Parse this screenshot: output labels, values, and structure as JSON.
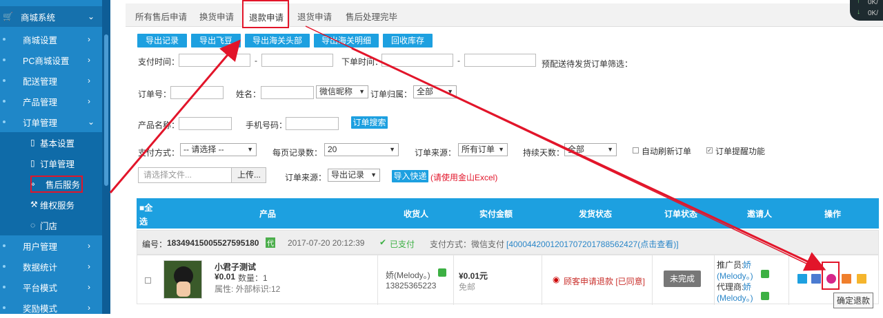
{
  "sidebar": {
    "header": "商城系统",
    "items": [
      {
        "label": "商城设置"
      },
      {
        "label": "PC商城设置"
      },
      {
        "label": "配送管理"
      },
      {
        "label": "产品管理"
      },
      {
        "label": "订单管理"
      }
    ],
    "subitems": [
      {
        "label": "基本设置"
      },
      {
        "label": "订单管理"
      },
      {
        "label": "售后服务"
      },
      {
        "label": "维权服务"
      },
      {
        "label": "门店"
      }
    ],
    "items2": [
      {
        "label": "用户管理"
      },
      {
        "label": "数据统计"
      },
      {
        "label": "平台模式"
      },
      {
        "label": "奖励模式"
      }
    ]
  },
  "tabs": [
    "所有售后申请",
    "换货申请",
    "退款申请",
    "退货申请",
    "售后处理完毕"
  ],
  "toolbar": [
    "导出记录",
    "导出飞豆",
    "导出海关头部",
    "导出海关明细",
    "回收库存"
  ],
  "filters": {
    "pay_time": "支付时间：",
    "dash": "-",
    "order_time": "下单时间：",
    "presale": "预配送待发货订单筛选：",
    "order_no": "订单号：",
    "name": "姓名：",
    "wechat_nick": "微信昵称",
    "belong": "订单归属：",
    "belong_value": "全部",
    "product_name": "产品名称：",
    "phone": "手机号码：",
    "search_btn": "订单搜索",
    "pay_method": "支付方式：",
    "pay_method_value": "-- 请选择 --",
    "per_page": "每页记录数：",
    "per_page_value": "20",
    "source": "订单来源：",
    "source_value": "所有订单",
    "days": "持续天数：",
    "days_value": "全部",
    "auto_refresh": "自动刷新订单",
    "reminder": "订单提醒功能",
    "file_placeholder": "请选择文件...",
    "upload_btn": "上传...",
    "source2": "订单来源：",
    "source2_value": "导出记录",
    "import_btn": "导入快递",
    "import_note": "(请使用金山Excel)"
  },
  "table": {
    "headers": [
      "■全选",
      "产品",
      "收货人",
      "实付金额",
      "发货状态",
      "订单状态",
      "邀请人",
      "操作"
    ],
    "order": {
      "number_label": "编号：",
      "number": "18349415005527595180",
      "badge": "代",
      "time": "2017-07-20 20:12:39",
      "paid": "已支付",
      "pay_method": "支付方式：微信支付",
      "trade_no": "[4000442001201707201788562427(点击查看)]"
    },
    "row": {
      "product_name": "小君子测试",
      "price": "¥0.01",
      "qty": "数量：1",
      "attr": "属性: 外部标识:12",
      "receiver": "娇(Melody。)",
      "receiver_phone": "13825365223",
      "amount": "¥0.01元",
      "shipping": "免邮",
      "ship_status": "顾客申请退款 [已同意]",
      "order_status": "未完成",
      "promoter_label": "推广员:",
      "promoter": "娇",
      "promoter2": "(Melody。)",
      "agent_label": "代理商:",
      "agent": "娇",
      "agent2": "(Melody。)"
    }
  },
  "tooltip": "确定退款",
  "corner": {
    "up": "0K/",
    "down": "0K/"
  },
  "colors": {
    "accent": "#1da0e0",
    "sidebar": "#1f87c8",
    "highlight": "#e2152a"
  }
}
